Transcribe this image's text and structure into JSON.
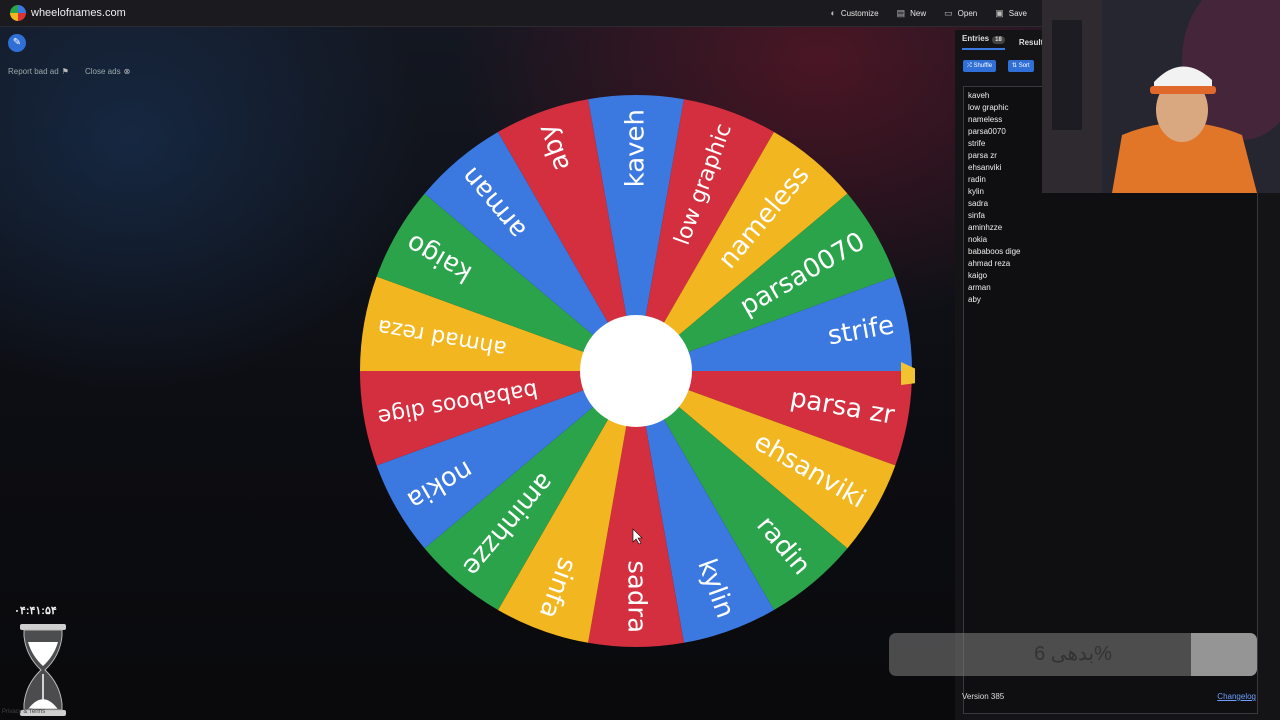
{
  "app": {
    "site_title": "wheelofnames.com",
    "nav": [
      {
        "label": "Customize",
        "icon": "palette-icon"
      },
      {
        "label": "New",
        "icon": "file-icon"
      },
      {
        "label": "Open",
        "icon": "folder-icon"
      },
      {
        "label": "Save",
        "icon": "save-icon"
      }
    ]
  },
  "ads": {
    "report_label": "Report bad ad",
    "close_label": "Close ads"
  },
  "wheel": {
    "colors": [
      "#3b78e0",
      "#d32f3f",
      "#f2b620",
      "#2aa34a"
    ],
    "entries": [
      "kaveh",
      "low graphic",
      "nameless",
      "parsa0070",
      "strife",
      "parsa zr",
      "ehsanviki",
      "radin",
      "kylin",
      "sadra",
      "sinfa",
      "aminhzze",
      "nokia",
      "bababoos dige",
      "ahmad reza",
      "kaigo",
      "arman",
      "aby"
    ]
  },
  "panel": {
    "tab_entries": "Entries",
    "entries_count": "18",
    "tab_results": "Result",
    "shuffle_label": "Shuffle",
    "sort_label": "Sort",
    "entries": [
      "kaveh",
      "low graphic",
      "nameless",
      "parsa0070",
      "strife",
      "parsa zr",
      "ehsanviki",
      "radin",
      "kylin",
      "sadra",
      "sinfa",
      "aminhzze",
      "nokia",
      "bababoos dige",
      "ahmad reza",
      "kaigo",
      "arman",
      "aby"
    ],
    "version": "Version 385",
    "changelog": "Changelog"
  },
  "overlay": {
    "progress_text": "بدهی 6%",
    "progress": 0.06,
    "timer": "۰۴:۴۱:۵۴",
    "privacy": "Privacy & Terms"
  }
}
